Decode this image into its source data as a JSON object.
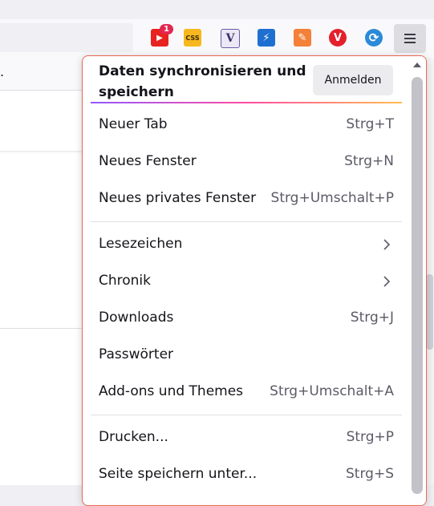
{
  "colors": {
    "accent": "#ea6a52",
    "toolbar": "#f9f9fb",
    "menu_bg": "#ffffff"
  },
  "toolbar": {
    "extensions": [
      {
        "name": "youtube-extension-icon",
        "glyph": "▶",
        "badge": "1",
        "color": "#e8231f"
      },
      {
        "name": "css-extension-icon",
        "glyph": "CSS",
        "color": "#f6b81e"
      },
      {
        "name": "v-extension-icon",
        "glyph": "V",
        "color": "#e7e4f3"
      },
      {
        "name": "bolt-extension-icon",
        "glyph": "⚡",
        "color": "#1f6fd0"
      },
      {
        "name": "edit-extension-icon",
        "glyph": "✎",
        "color": "#f4803a"
      },
      {
        "name": "vivaldi-extension-icon",
        "glyph": "V",
        "color": "#e3202b"
      },
      {
        "name": "sync-extension-icon",
        "glyph": "⟳",
        "color": "#2b8ad8"
      }
    ],
    "bookmark_overflow": "."
  },
  "menu": {
    "sync_title": "Daten synchronisieren und speichern",
    "signin_label": "Anmelden",
    "group1": [
      {
        "label": "Neuer Tab",
        "shortcut": "Strg+T"
      },
      {
        "label": "Neues Fenster",
        "shortcut": "Strg+N"
      },
      {
        "label": "Neues privates Fenster",
        "shortcut": "Strg+Umschalt+P"
      }
    ],
    "group2": [
      {
        "label": "Lesezeichen",
        "shortcut": ""
      },
      {
        "label": "Chronik",
        "shortcut": ""
      },
      {
        "label": "Downloads",
        "shortcut": "Strg+J"
      },
      {
        "label": "Passwörter",
        "shortcut": ""
      },
      {
        "label": "Add-ons und Themes",
        "shortcut": "Strg+Umschalt+A"
      }
    ],
    "group3": [
      {
        "label": "Drucken...",
        "shortcut": "Strg+P"
      },
      {
        "label": "Seite speichern unter...",
        "shortcut": "Strg+S"
      }
    ]
  }
}
